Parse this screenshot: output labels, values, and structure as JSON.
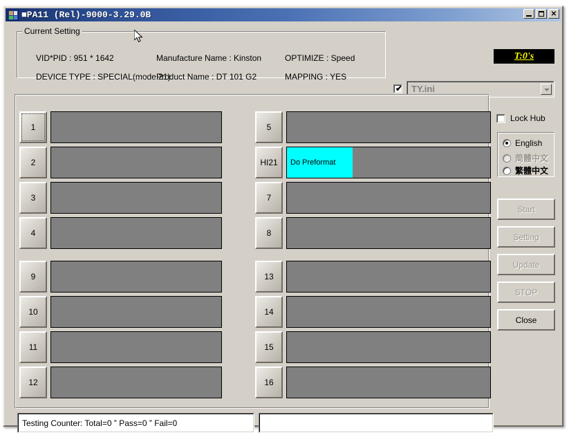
{
  "window": {
    "title": "■PA11 (Rel)-9000-3.29.0B",
    "icon": "app-icon",
    "minimize_label": "_",
    "maximize_label": "□",
    "close_label": "✕"
  },
  "current_setting": {
    "legend": "Current Setting",
    "vid_pid": "VID*PID :  951 * 1642",
    "device_type": "DEVICE TYPE : SPECIAL(mode 21)",
    "manufacture_name": "Manufacture Name : Kinston",
    "product_name": "Product Name : DT 101 G2",
    "optimize": "OPTIMIZE : Speed",
    "mapping": "MAPPING : YES"
  },
  "timer": {
    "text": "T:0's",
    "fg": "#ffff00",
    "bg": "#000000"
  },
  "ini_selector": {
    "checkbox_checked": true,
    "checkbox_glyph": "✔",
    "value": "TY.ini",
    "arrow": "chevron-down-icon",
    "enabled": false
  },
  "ports": {
    "left": [
      {
        "label": "1",
        "status": "",
        "focused": true
      },
      {
        "label": "2",
        "status": "",
        "focused": false
      },
      {
        "label": "3",
        "status": "",
        "focused": false
      },
      {
        "label": "4",
        "status": "",
        "focused": false
      },
      {
        "label": "9",
        "status": "",
        "focused": false
      },
      {
        "label": "10",
        "status": "",
        "focused": false
      },
      {
        "label": "11",
        "status": "",
        "focused": false
      },
      {
        "label": "12",
        "status": "",
        "focused": false
      }
    ],
    "right": [
      {
        "label": "5",
        "status": "",
        "focused": false
      },
      {
        "label": "HI21",
        "status": "Do Preformat",
        "status_bg": "#00ffff",
        "status_width": 95,
        "focused": false
      },
      {
        "label": "7",
        "status": "",
        "focused": false
      },
      {
        "label": "8",
        "status": "",
        "focused": false
      },
      {
        "label": "13",
        "status": "",
        "focused": false
      },
      {
        "label": "14",
        "status": "",
        "focused": false
      },
      {
        "label": "15",
        "status": "",
        "focused": false
      },
      {
        "label": "16",
        "status": "",
        "focused": false
      }
    ],
    "slot_bg": "#808080"
  },
  "side_panel": {
    "lock_hub": {
      "label": "Lock Hub",
      "checked": false
    },
    "language": {
      "options": [
        {
          "label": "English",
          "selected": true,
          "disabled": false
        },
        {
          "label": "简體中文",
          "selected": false,
          "disabled": true
        },
        {
          "label": "繁體中文",
          "selected": false,
          "disabled": false
        }
      ]
    },
    "buttons": [
      {
        "label": "Start",
        "enabled": false
      },
      {
        "label": "Setting",
        "enabled": false
      },
      {
        "label": "Update",
        "enabled": false
      },
      {
        "label": "STOP",
        "enabled": false
      },
      {
        "label": "Close",
        "enabled": true
      }
    ]
  },
  "status_bar": {
    "left_text": "Testing Counter: Total=0 ˮ Pass=0 ˮ Fail=0",
    "right_text": ""
  }
}
